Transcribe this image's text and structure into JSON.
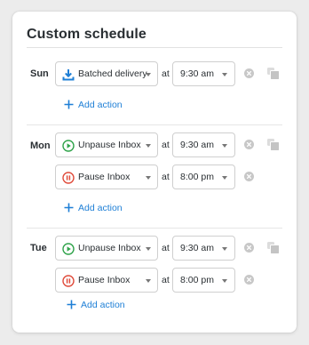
{
  "title": "Custom schedule",
  "colors": {
    "accent": "#1e7fd6",
    "unpause_green": "#2fa34a",
    "pause_red": "#e04b3b",
    "delivery_blue": "#1e7fd6"
  },
  "days": [
    {
      "day": "Sun",
      "rows": [
        {
          "action": "Batched delivery",
          "icon": "download-tray-icon",
          "at": "at",
          "time": "9:30 am",
          "show_copy": true
        }
      ],
      "add_label": "Add action"
    },
    {
      "day": "Mon",
      "rows": [
        {
          "action": "Unpause Inbox",
          "icon": "play-circle-icon",
          "at": "at",
          "time": "9:30 am",
          "show_copy": true
        },
        {
          "action": "Pause Inbox",
          "icon": "pause-circle-icon",
          "at": "at",
          "time": "8:00 pm",
          "show_copy": false
        }
      ],
      "add_label": "Add action"
    },
    {
      "day": "Tue",
      "rows": [
        {
          "action": "Unpause Inbox",
          "icon": "play-circle-icon",
          "at": "at",
          "time": "9:30 am",
          "show_copy": true
        },
        {
          "action": "Pause Inbox",
          "icon": "pause-circle-icon",
          "at": "at",
          "time": "8:00 pm",
          "show_copy": false
        }
      ],
      "add_label": "Add action"
    }
  ]
}
